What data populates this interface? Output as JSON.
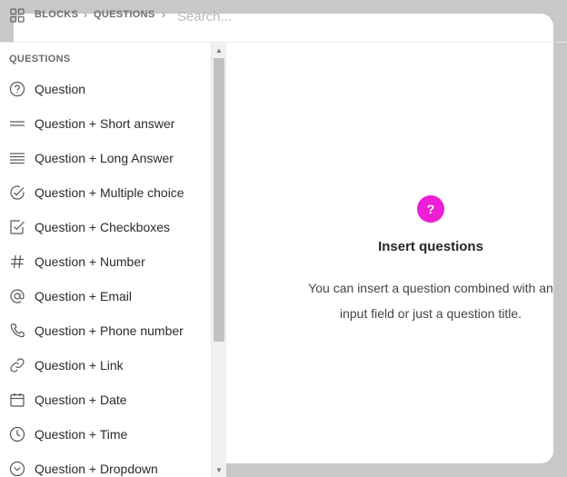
{
  "breadcrumb": {
    "root": "BLOCKS",
    "current": "QUESTIONS"
  },
  "search": {
    "placeholder": "Search...",
    "value": ""
  },
  "sidebar": {
    "section_title": "QUESTIONS",
    "items": [
      {
        "label": "Question",
        "icon": "question-circle-icon"
      },
      {
        "label": "Question + Short answer",
        "icon": "short-answer-icon"
      },
      {
        "label": "Question + Long Answer",
        "icon": "long-answer-icon"
      },
      {
        "label": "Question + Multiple choice",
        "icon": "check-circle-icon"
      },
      {
        "label": "Question + Checkboxes",
        "icon": "checkbox-icon"
      },
      {
        "label": "Question + Number",
        "icon": "hash-icon"
      },
      {
        "label": "Question + Email",
        "icon": "at-icon"
      },
      {
        "label": "Question + Phone number",
        "icon": "phone-icon"
      },
      {
        "label": "Question + Link",
        "icon": "link-icon"
      },
      {
        "label": "Question + Date",
        "icon": "calendar-icon"
      },
      {
        "label": "Question + Time",
        "icon": "clock-icon"
      },
      {
        "label": "Question + Dropdown",
        "icon": "chevron-circle-icon"
      }
    ]
  },
  "detail": {
    "badge": "?",
    "title": "Insert questions",
    "description": "You can insert a question combined with an input field or just a question title."
  },
  "colors": {
    "accent": "#ec1fd6",
    "backdrop": "#c8c8c8"
  }
}
